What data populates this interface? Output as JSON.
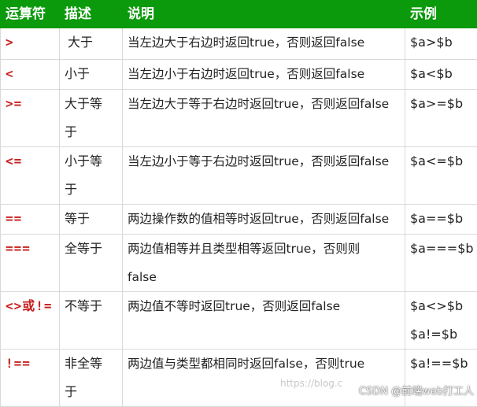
{
  "table": {
    "headers": [
      "运算符",
      "描述",
      "说明",
      "示例"
    ],
    "rows": [
      {
        "op": ">",
        "desc": [
          "大于"
        ],
        "explain": [
          "当左边大于右边时返回true，否则返回false"
        ],
        "example": [
          "$a>$b"
        ]
      },
      {
        "op": "<",
        "desc": [
          "小于"
        ],
        "explain": [
          "当左边小于右边时返回true，否则返回false"
        ],
        "example": [
          "$a<$b"
        ]
      },
      {
        "op": ">=",
        "desc": [
          "大于等",
          "于"
        ],
        "explain": [
          "当左边大于等于右边时返回true，否则返回false"
        ],
        "example": [
          "$a>=$b"
        ]
      },
      {
        "op": "<=",
        "desc": [
          "小于等",
          "于"
        ],
        "explain": [
          "当左边小于等于右边时返回true，否则返回false"
        ],
        "example": [
          "$a<=$b"
        ]
      },
      {
        "op": "==",
        "desc": [
          "等于"
        ],
        "explain": [
          "两边操作数的值相等时返回true，否则返回false"
        ],
        "example": [
          "$a==$b"
        ]
      },
      {
        "op": "===",
        "desc": [
          "全等于"
        ],
        "explain": [
          "两边值相等并且类型相等返回true，否则则",
          "false"
        ],
        "example": [
          "$a===$b"
        ]
      },
      {
        "op": "<>或!=",
        "desc": [
          "不等于"
        ],
        "explain": [
          "两边值不等时返回true，否则返回false"
        ],
        "example": [
          "$a<>$b",
          "$a!=$b"
        ]
      },
      {
        "op": "!==",
        "desc": [
          "非全等",
          "于"
        ],
        "explain": [
          "两边值与类型都相同时返回false，否则true"
        ],
        "example": [
          "$a!==$b"
        ]
      }
    ]
  },
  "watermark": {
    "faint": "https://blog.c",
    "brand": "CSDN @前端web打工人"
  }
}
